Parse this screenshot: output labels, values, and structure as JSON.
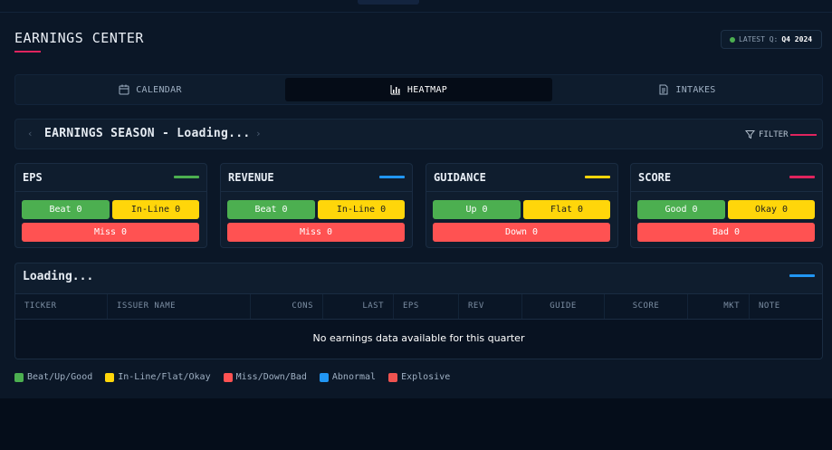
{
  "header": {
    "title": "EARNINGS CENTER",
    "latest_label": "LATEST Q:",
    "latest_value": "Q4 2024"
  },
  "colors": {
    "accent": "#e0245e",
    "green": "#4caf50",
    "yellow": "#ffd60a",
    "red": "#ff5252",
    "blue": "#2196f3",
    "explosive": "#ef5350"
  },
  "tabs": [
    {
      "label": "CALENDAR",
      "icon": "calendar-icon"
    },
    {
      "label": "HEATMAP",
      "icon": "bar-chart-icon",
      "active": true
    },
    {
      "label": "INTAKES",
      "icon": "document-icon"
    }
  ],
  "season": {
    "label": "EARNINGS SEASON - Loading...",
    "prev_icon": "chevron-left-icon",
    "next_icon": "chevron-right-icon",
    "filter_label": "FILTER",
    "filter_icon": "filter-icon"
  },
  "cards": [
    {
      "title": "EPS",
      "color": "#4caf50",
      "pills": [
        "Beat 0",
        "In-Line 0",
        "Miss 0"
      ]
    },
    {
      "title": "REVENUE",
      "color": "#2196f3",
      "pills": [
        "Beat 0",
        "In-Line 0",
        "Miss 0"
      ]
    },
    {
      "title": "GUIDANCE",
      "color": "#ffd60a",
      "pills": [
        "Up 0",
        "Flat 0",
        "Down 0"
      ]
    },
    {
      "title": "SCORE",
      "color": "#e0245e",
      "pills": [
        "Good 0",
        "Okay 0",
        "Bad 0"
      ]
    }
  ],
  "table": {
    "title": "Loading...",
    "columns": [
      "TICKER",
      "ISSUER NAME",
      "CONS",
      "LAST",
      "EPS",
      "REV",
      "GUIDE",
      "SCORE",
      "MKT",
      "NOTE"
    ],
    "empty_message": "No earnings data available for this quarter"
  },
  "legend": [
    {
      "label": "Beat/Up/Good",
      "color": "#4caf50"
    },
    {
      "label": "In-Line/Flat/Okay",
      "color": "#ffd60a"
    },
    {
      "label": "Miss/Down/Bad",
      "color": "#ff5252"
    },
    {
      "label": "Abnormal",
      "color": "#2196f3"
    },
    {
      "label": "Explosive",
      "color": "#ef5350"
    }
  ]
}
